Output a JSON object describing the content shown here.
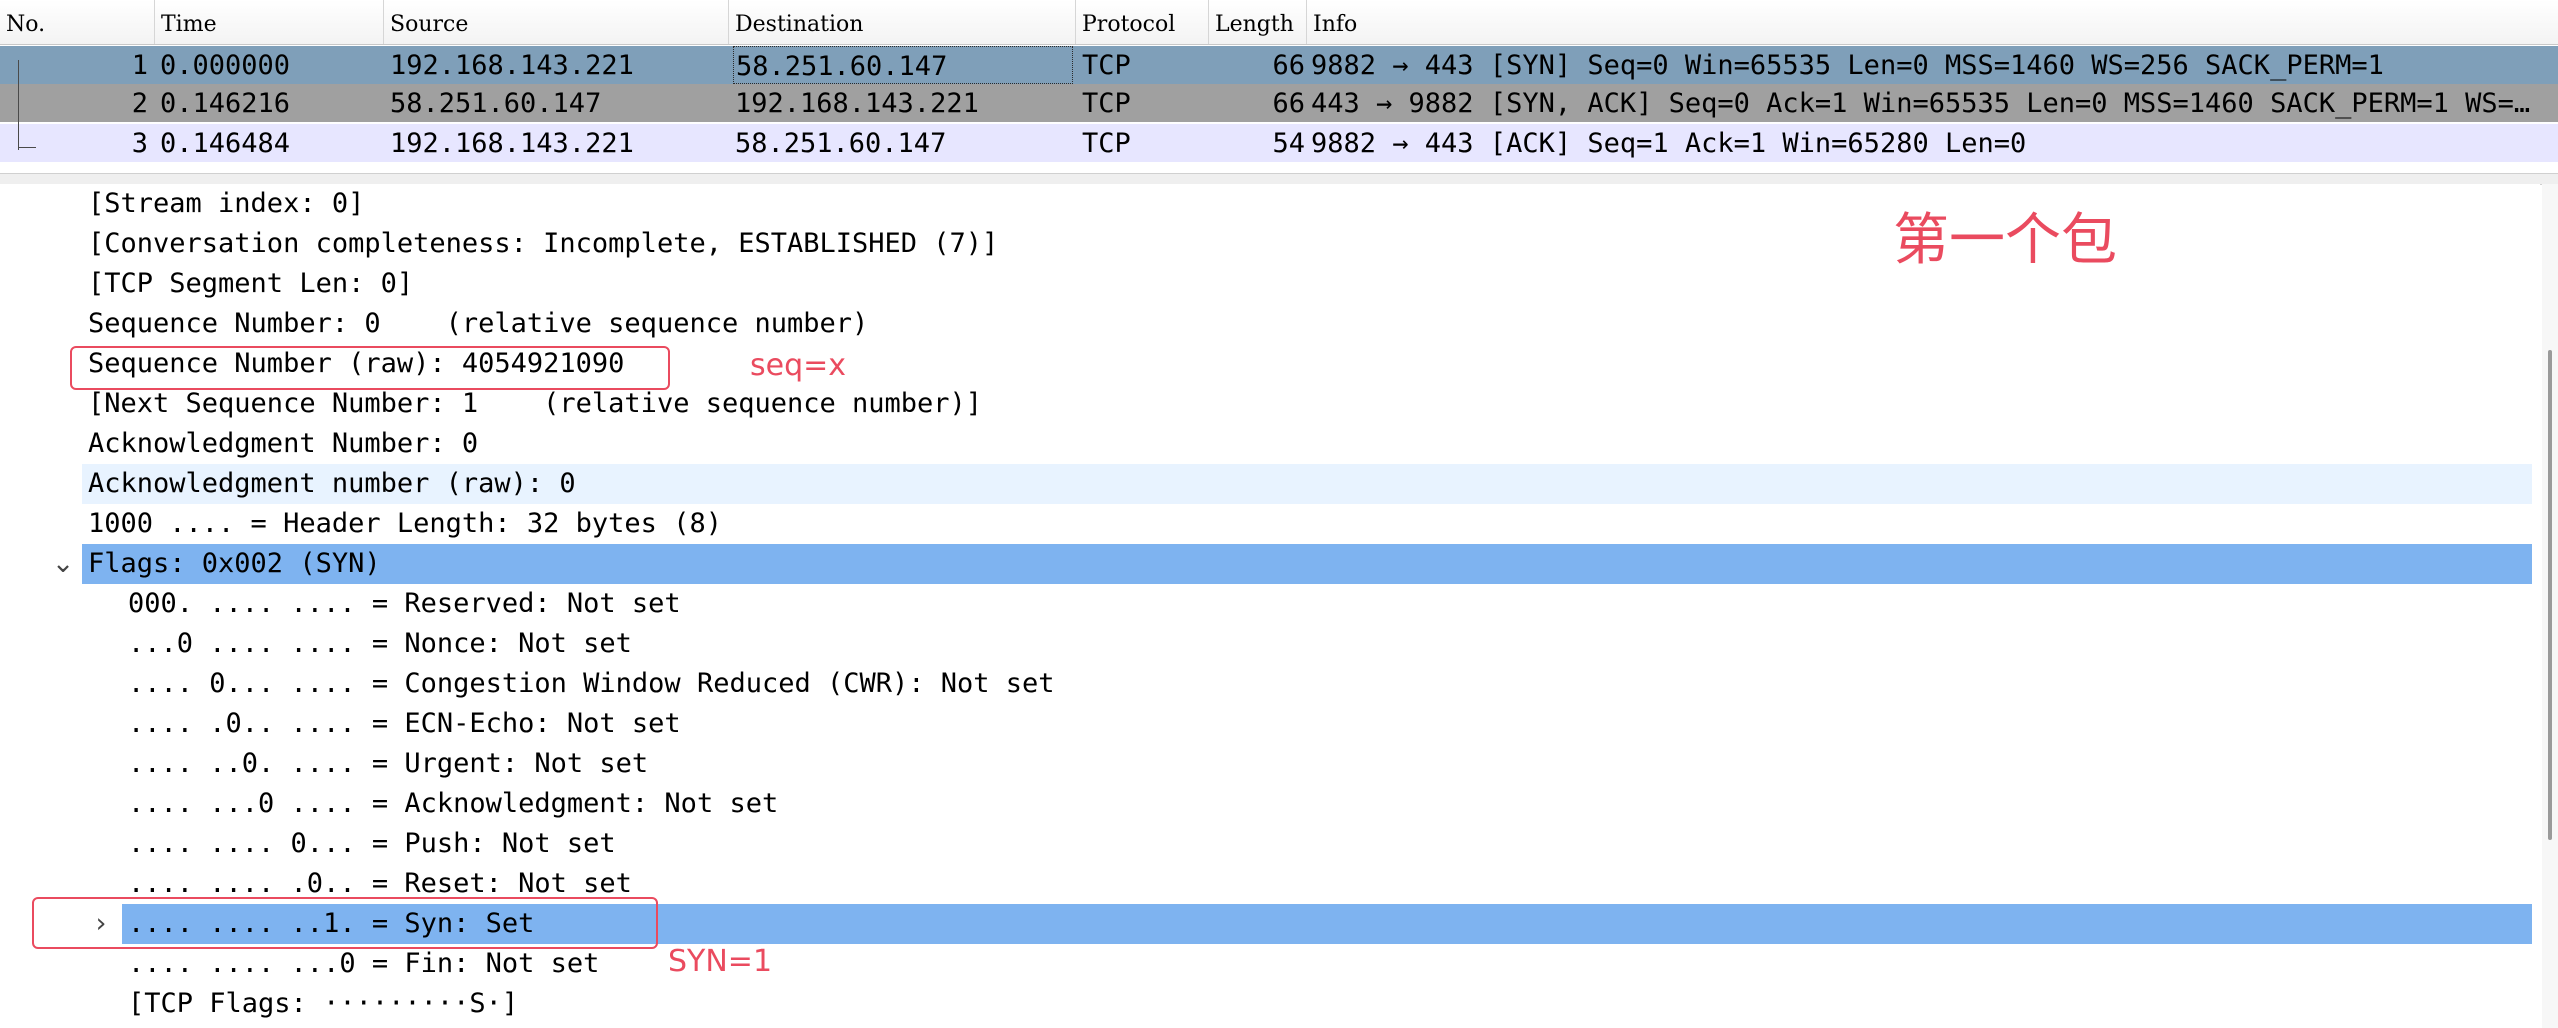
{
  "columns": {
    "no": "No.",
    "time": "Time",
    "source": "Source",
    "destination": "Destination",
    "protocol": "Protocol",
    "length": "Length",
    "info": "Info"
  },
  "packets": [
    {
      "no": "1",
      "time": "0.000000",
      "source": "192.168.143.221",
      "destination": "58.251.60.147",
      "protocol": "TCP",
      "length": "66",
      "info": "9882 → 443 [SYN] Seq=0 Win=65535 Len=0 MSS=1460 WS=256 SACK_PERM=1"
    },
    {
      "no": "2",
      "time": "0.146216",
      "source": "58.251.60.147",
      "destination": "192.168.143.221",
      "protocol": "TCP",
      "length": "66",
      "info": "443 → 9882 [SYN, ACK] Seq=0 Ack=1 Win=65535 Len=0 MSS=1460 SACK_PERM=1 WS=…"
    },
    {
      "no": "3",
      "time": "0.146484",
      "source": "192.168.143.221",
      "destination": "58.251.60.147",
      "protocol": "TCP",
      "length": "54",
      "info": "9882 → 443 [ACK] Seq=1 Ack=1 Win=65280 Len=0"
    }
  ],
  "details": [
    "[Stream index: 0]",
    "[Conversation completeness: Incomplete, ESTABLISHED (7)]",
    "[TCP Segment Len: 0]",
    "Sequence Number: 0    (relative sequence number)",
    "Sequence Number (raw): 4054921090",
    "[Next Sequence Number: 1    (relative sequence number)]",
    "Acknowledgment Number: 0",
    "Acknowledgment number (raw): 0",
    "1000 .... = Header Length: 32 bytes (8)",
    "Flags: 0x002 (SYN)",
    "000. .... .... = Reserved: Not set",
    "...0 .... .... = Nonce: Not set",
    ".... 0... .... = Congestion Window Reduced (CWR): Not set",
    ".... .0.. .... = ECN-Echo: Not set",
    ".... ..0. .... = Urgent: Not set",
    ".... ...0 .... = Acknowledgment: Not set",
    ".... .... 0... = Push: Not set",
    ".... .... .0.. = Reset: Not set",
    ".... .... ..1. = Syn: Set",
    ".... .... ...0 = Fin: Not set",
    "[TCP Flags: ·········S·]"
  ],
  "toggles": {
    "flags": "⌄",
    "syn": "›"
  },
  "annotations": {
    "first_packet": "第一个包",
    "seq": "seq=x",
    "syn": "SYN=1"
  },
  "colors": {
    "selected_row": "#7f9fb9",
    "annotation": "#ea4b5f",
    "detail_highlight": "#7eb3f0"
  }
}
